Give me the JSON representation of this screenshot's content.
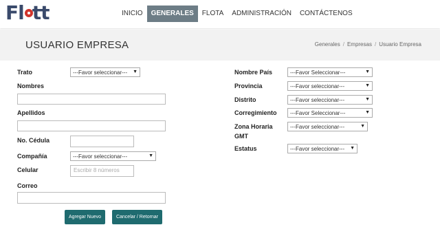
{
  "brand": {
    "part1": "Fl",
    "part2": "tt"
  },
  "nav": [
    {
      "label": "INICIO",
      "active": false
    },
    {
      "label": "GENERALES",
      "active": true
    },
    {
      "label": "FLOTA",
      "active": false
    },
    {
      "label": "ADMINISTRACIÓN",
      "active": false
    },
    {
      "label": "CONTÁCTENOS",
      "active": false
    }
  ],
  "header": {
    "title": "USUARIO EMPRESA",
    "breadcrumb": [
      "Generales",
      "Empresas",
      "Usuario Empresa"
    ]
  },
  "form_left": {
    "trato": {
      "label": "Trato",
      "value": "---Favor seleccionar---"
    },
    "nombres": {
      "label": "Nombres",
      "value": ""
    },
    "apellidos": {
      "label": "Apellidos",
      "value": ""
    },
    "cedula": {
      "label": "No. Cédula",
      "value": ""
    },
    "compania": {
      "label": "Compañía",
      "value": "---Favor seleccionar---"
    },
    "celular": {
      "label": "Celular",
      "placeholder": "Escribir 8 números"
    },
    "correo": {
      "label": "Correo",
      "value": ""
    }
  },
  "form_right": {
    "pais": {
      "label": "Nombre País",
      "value": "---Favor Seleccionar---"
    },
    "provincia": {
      "label": "Provincia",
      "value": "---Favor seleccionar---"
    },
    "distrito": {
      "label": "Distrito",
      "value": "---Favor seleccionar---"
    },
    "corregimiento": {
      "label": "Corregimiento",
      "value": "---Favor Seleccionar---"
    },
    "zona_horaria": {
      "label_line1": "Zona Horaria",
      "label_line2": "GMT",
      "value": "---Favor seleccionar---"
    },
    "estatus": {
      "label": "Estatus",
      "value": "---Favor seleccionar---"
    }
  },
  "buttons": {
    "add": "Agregar Nuevo",
    "cancel": "Cancelar / Retornar"
  },
  "colors": {
    "brand": "#3a4a6b",
    "logo_ring": "#d0342c",
    "nav_active": "#6d7d86",
    "button": "#1f6b6f"
  }
}
